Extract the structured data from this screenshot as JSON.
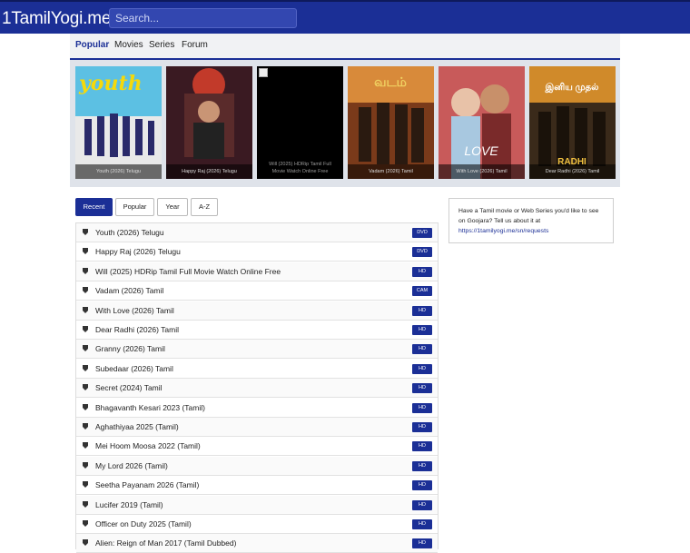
{
  "header": {
    "logo": "1TamilYogi.me",
    "search_placeholder": "Search..."
  },
  "nav": {
    "items": [
      {
        "label": "Popular",
        "active": true
      },
      {
        "label": "Movies",
        "active": false
      },
      {
        "label": "Series",
        "active": false
      },
      {
        "label": "Forum",
        "active": false
      }
    ]
  },
  "featured": [
    {
      "title": "Youth (2026) Telugu",
      "image": true
    },
    {
      "title": "Happy Raj (2026) Telugu",
      "image": true
    },
    {
      "title": "Will (2025) HDRip Tamil Full Movie Watch Online Free",
      "image": false
    },
    {
      "title": "Vadam (2026) Tamil",
      "image": true
    },
    {
      "title": "With Love (2026) Tamil",
      "image": true
    },
    {
      "title": "Dear Radhi (2026) Tamil",
      "image": true
    }
  ],
  "tabs": [
    {
      "label": "Recent",
      "active": true
    },
    {
      "label": "Popular",
      "active": false
    },
    {
      "label": "Year",
      "active": false
    },
    {
      "label": "A-Z",
      "active": false
    }
  ],
  "movies": [
    {
      "title": "Youth (2026) Telugu",
      "quality": "DVD"
    },
    {
      "title": "Happy Raj (2026) Telugu",
      "quality": "DVD"
    },
    {
      "title": "Will (2025) HDRip Tamil Full Movie Watch Online Free",
      "quality": "HD"
    },
    {
      "title": "Vadam (2026) Tamil",
      "quality": "CAM"
    },
    {
      "title": "With Love (2026) Tamil",
      "quality": "HD"
    },
    {
      "title": "Dear Radhi (2026) Tamil",
      "quality": "HD"
    },
    {
      "title": "Granny (2026) Tamil",
      "quality": "HD"
    },
    {
      "title": "Subedaar (2026) Tamil",
      "quality": "HD"
    },
    {
      "title": "Secret (2024) Tamil",
      "quality": "HD"
    },
    {
      "title": "Bhagavanth Kesari 2023 (Tamil)",
      "quality": "HD"
    },
    {
      "title": "Aghathiyaa 2025 (Tamil)",
      "quality": "HD"
    },
    {
      "title": "Mei Hoom Moosa 2022 (Tamil)",
      "quality": "HD"
    },
    {
      "title": "My Lord 2026 (Tamil)",
      "quality": "HD"
    },
    {
      "title": "Seetha Payanam 2026 (Tamil)",
      "quality": "HD"
    },
    {
      "title": "Lucifer 2019 (Tamil)",
      "quality": "HD"
    },
    {
      "title": "Officer on Duty 2025 (Tamil)",
      "quality": "HD"
    },
    {
      "title": "Alien: Reign of Man 2017 (Tamil Dubbed)",
      "quality": "HD"
    }
  ],
  "sidebar": {
    "text": "Have a Tamil movie or Web Series you'd like to see on Goojara? Tell us about it at",
    "link": "https://1tamilyogi.me/sn/requests"
  },
  "colors": {
    "brand": "#1b2f96",
    "badge": "#1b2f96"
  }
}
